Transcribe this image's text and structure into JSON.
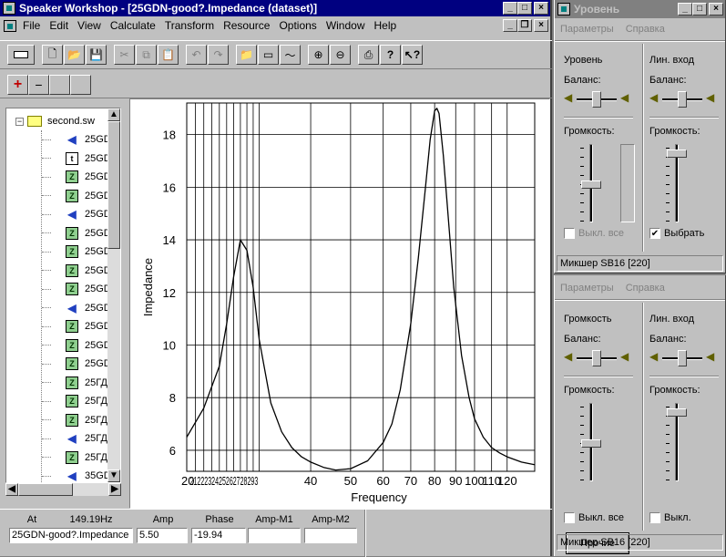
{
  "main_window": {
    "title": "Speaker Workshop - [25GDN-good?.Impedance (dataset)]",
    "menu": [
      "File",
      "Edit",
      "View",
      "Calculate",
      "Transform",
      "Resource",
      "Options",
      "Window",
      "Help"
    ],
    "toolbar_icons": [
      "view-icon",
      "new-icon",
      "open-icon",
      "save-icon",
      "cut-icon",
      "copy-icon",
      "paste-icon",
      "undo-icon",
      "redo-icon",
      "open-folder-icon",
      "chart-icon",
      "graph-icon",
      "zoom-in-icon",
      "zoom-out-icon",
      "print-icon",
      "help-icon",
      "context-help-icon"
    ],
    "tree_toolbar": {
      "add": "+",
      "remove": "−"
    }
  },
  "tree": {
    "root": "second.sw",
    "items": [
      {
        "type": "s",
        "label": "25GD"
      },
      {
        "type": "t",
        "label": "25GD"
      },
      {
        "type": "z",
        "label": "25GD"
      },
      {
        "type": "z",
        "label": "25GD"
      },
      {
        "type": "s",
        "label": "25GD"
      },
      {
        "type": "z",
        "label": "25GD"
      },
      {
        "type": "z",
        "label": "25GD"
      },
      {
        "type": "z",
        "label": "25GD"
      },
      {
        "type": "z",
        "label": "25GD"
      },
      {
        "type": "s",
        "label": "25GD"
      },
      {
        "type": "z",
        "label": "25GD"
      },
      {
        "type": "z",
        "label": "25GD"
      },
      {
        "type": "z",
        "label": "25GD"
      },
      {
        "type": "z",
        "label": "25ГД"
      },
      {
        "type": "z",
        "label": "25ГД"
      },
      {
        "type": "z",
        "label": "25ГД"
      },
      {
        "type": "s",
        "label": "25ГД"
      },
      {
        "type": "z",
        "label": "25ГД"
      },
      {
        "type": "s",
        "label": "35GD"
      }
    ],
    "icon_letters": {
      "z": "Z",
      "t": "t",
      "s": "◀"
    }
  },
  "chart_data": {
    "type": "line",
    "xlabel": "Frequency",
    "ylabel": "Impedance",
    "x_scale": "log",
    "xlim": [
      20,
      140
    ],
    "ylim": [
      5.2,
      19.2
    ],
    "yticks": [
      6,
      8,
      10,
      12,
      14,
      16,
      18
    ],
    "xticks": [
      20,
      21,
      22,
      23,
      24,
      25,
      26,
      27,
      28,
      29,
      30,
      40,
      50,
      60,
      70,
      80,
      90,
      100,
      110,
      120
    ],
    "xtick_labels_overlapped": "2122232425262728293",
    "xtick_labels": [
      "40",
      "50",
      "60",
      "70",
      "80",
      "90",
      "100",
      "110",
      "120"
    ],
    "xtick_first_label": "20",
    "grid": true,
    "series": [
      {
        "color": "#000000",
        "x": [
          20,
          22,
          24,
          25,
          26,
          27,
          28,
          29,
          30,
          32,
          34,
          36,
          38,
          40,
          43,
          46,
          50,
          55,
          60,
          63,
          66,
          70,
          73,
          76,
          78,
          80,
          81,
          82,
          84,
          86,
          89,
          93,
          97,
          100,
          105,
          110,
          115,
          120,
          130,
          140
        ],
        "y": [
          6.5,
          7.6,
          9.2,
          10.8,
          12.6,
          14.0,
          13.6,
          12.2,
          10.2,
          7.8,
          6.7,
          6.1,
          5.75,
          5.55,
          5.35,
          5.25,
          5.3,
          5.6,
          6.3,
          7.0,
          8.3,
          10.8,
          13.3,
          16.0,
          17.8,
          18.9,
          19.0,
          18.8,
          17.2,
          15.2,
          12.2,
          9.6,
          8.0,
          7.2,
          6.5,
          6.1,
          5.9,
          5.75,
          5.55,
          5.45
        ]
      }
    ]
  },
  "status": {
    "headers": {
      "at": "At",
      "freq": "149.19Hz",
      "amp": "Amp",
      "phase": "Phase",
      "amp_m1": "Amp-M1",
      "amp_m2": "Amp-M2"
    },
    "values": {
      "name": "25GDN-good?.Impedance",
      "amp": "5.50",
      "phase": "-19.94",
      "amp_m1": "",
      "amp_m2": ""
    }
  },
  "mixer1": {
    "title": "Уровень",
    "menu": [
      "Параметры",
      "Справка"
    ],
    "col1": {
      "title": "Уровень",
      "balance": "Баланс:",
      "volume": "Громкость:",
      "checkbox": "Выкл. все",
      "checked": false,
      "level": 0.48
    },
    "col2": {
      "title": "Лин. вход",
      "balance": "Баланс:",
      "volume": "Громкость:",
      "checkbox": "Выбрать",
      "checked": true,
      "level": 0.92
    },
    "status": "Микшер SB16 [220]"
  },
  "mixer2": {
    "menu": [
      "Параметры",
      "Справка"
    ],
    "col1": {
      "title": "Громкость",
      "balance": "Баланс:",
      "volume": "Громкость:",
      "checkbox": "Выкл. все",
      "checked": false,
      "level": 0.48,
      "button": "Прочие"
    },
    "col2": {
      "title": "Лин. вход",
      "balance": "Баланс:",
      "volume": "Громкость:",
      "checkbox": "Выкл.",
      "checked": false,
      "level": 0.92
    },
    "status": "Микшер SB16 [220]"
  }
}
